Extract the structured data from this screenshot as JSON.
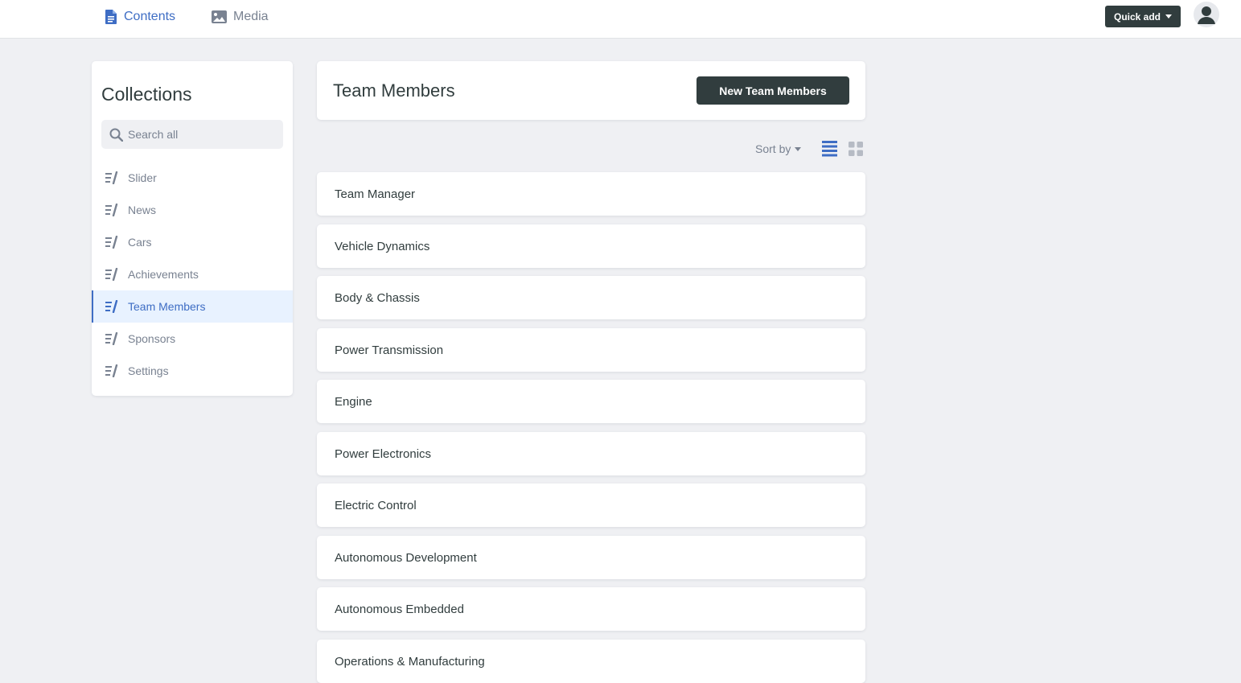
{
  "topbar": {
    "tabs": [
      {
        "label": "Contents",
        "icon": "document-icon",
        "active": true
      },
      {
        "label": "Media",
        "icon": "image-icon",
        "active": false
      }
    ],
    "quick_add_label": "Quick add",
    "avatar_icon": "user-icon"
  },
  "sidebar": {
    "title": "Collections",
    "search_placeholder": "Search all",
    "items": [
      {
        "label": "Slider"
      },
      {
        "label": "News"
      },
      {
        "label": "Cars"
      },
      {
        "label": "Achievements"
      },
      {
        "label": "Team Members",
        "active": true
      },
      {
        "label": "Sponsors"
      },
      {
        "label": "Settings"
      }
    ]
  },
  "main": {
    "title": "Team Members",
    "new_button_label": "New Team Members",
    "sort_label": "Sort by",
    "view_mode": "list",
    "entries": [
      "Team Manager",
      "Vehicle Dynamics",
      "Body & Chassis",
      "Power Transmission",
      "Engine",
      "Power Electronics",
      "Electric Control",
      "Autonomous Development",
      "Autonomous Embedded",
      "Operations & Manufacturing"
    ]
  },
  "colors": {
    "accent": "#3e6dc4",
    "dark_button": "#313d3e",
    "background": "#eff0f3",
    "muted_text": "#798291"
  }
}
